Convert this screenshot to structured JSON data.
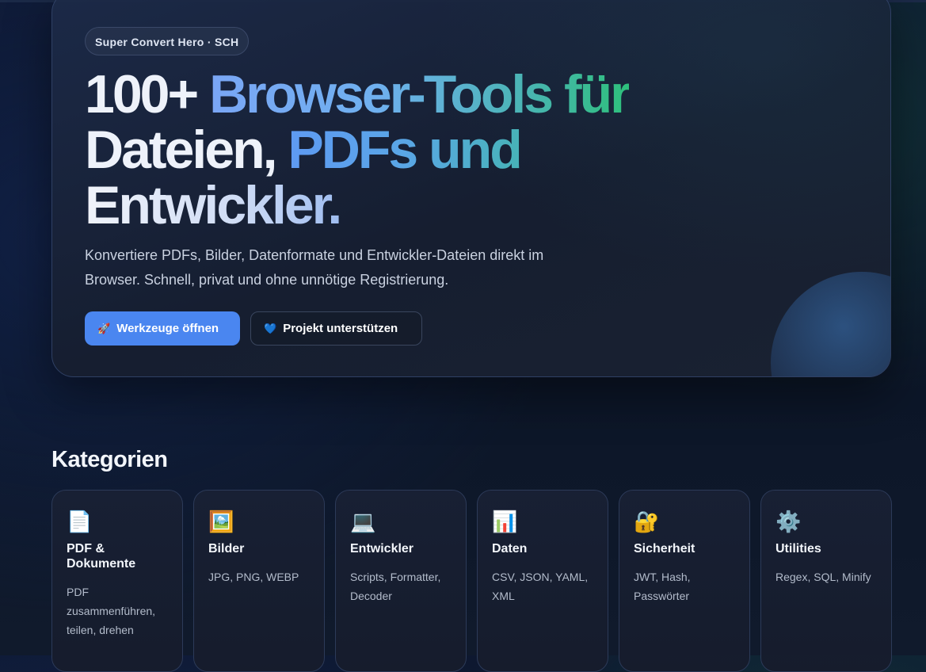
{
  "hero": {
    "badge": "Super Convert Hero · SCH",
    "title_a": "100+ ",
    "title_b": "Browser-Tools für",
    "title_c": "Dateien, ",
    "title_d": "PDFs und",
    "title_e": "Entwickler.",
    "lead": "Konvertiere PDFs, Bilder, Datenformate und Entwickler-Dateien direkt im Browser. Schnell, privat und ohne unnötige Registrierung.",
    "primary_icon": "🚀",
    "primary_label": "Werkzeuge öffnen",
    "secondary_icon": "💙",
    "secondary_label": "Projekt unterstützen"
  },
  "categories": {
    "heading": "Kategorien",
    "items": [
      {
        "icon": "📄",
        "icon_name": "document-icon",
        "name": "PDF & Dokumente",
        "desc": "PDF zusammenführen, teilen, drehen"
      },
      {
        "icon": "🖼️",
        "icon_name": "image-icon",
        "name": "Bilder",
        "desc": "JPG, PNG, WEBP"
      },
      {
        "icon": "💻",
        "icon_name": "laptop-icon",
        "name": "Entwickler",
        "desc": "Scripts, Formatter, Decoder"
      },
      {
        "icon": "📊",
        "icon_name": "chart-icon",
        "name": "Daten",
        "desc": "CSV, JSON, YAML, XML"
      },
      {
        "icon": "🔐",
        "icon_name": "lock-icon",
        "name": "Sicherheit",
        "desc": "JWT, Hash, Passwörter"
      },
      {
        "icon": "⚙️",
        "icon_name": "gear-icon",
        "name": "Utilities",
        "desc": "Regex, SQL, Minify"
      }
    ]
  }
}
